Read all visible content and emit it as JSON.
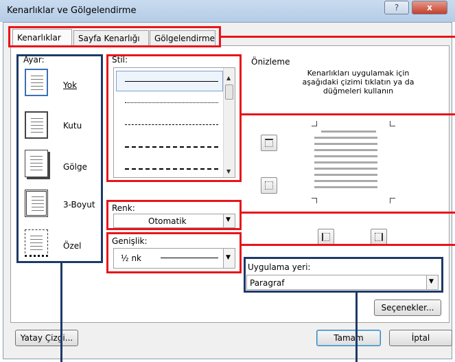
{
  "window": {
    "title": "Kenarlıklar ve Gölgelendirme",
    "help_label": "?",
    "close_label": "x"
  },
  "tabs": [
    {
      "label": "Kenarlıklar"
    },
    {
      "label": "Sayfa Kenarlığı"
    },
    {
      "label": "Gölgelendirme"
    }
  ],
  "setting": {
    "label": "Ayar:",
    "items": [
      {
        "label": "Yok"
      },
      {
        "label": "Kutu"
      },
      {
        "label": "Gölge"
      },
      {
        "label": "3-Boyut"
      },
      {
        "label": "Özel"
      }
    ]
  },
  "style": {
    "label": "Stil:"
  },
  "color": {
    "label": "Renk:",
    "value": "Otomatik"
  },
  "width": {
    "label": "Genişlik:",
    "value": "½ nk"
  },
  "preview": {
    "label": "Önizleme",
    "instructions": "Kenarlıkları uygulamak için aşağıdaki çizimi tıklatın ya da düğmeleri kullanın"
  },
  "apply_to": {
    "label": "Uygulama yeri:",
    "value": "Paragraf"
  },
  "buttons": {
    "options": "Seçenekler...",
    "horizontal_line": "Yatay Çizgi...",
    "ok": "Tamam",
    "cancel": "İptal"
  },
  "annotation_colors": {
    "red": "#e8141b",
    "blue": "#1c3a66"
  }
}
